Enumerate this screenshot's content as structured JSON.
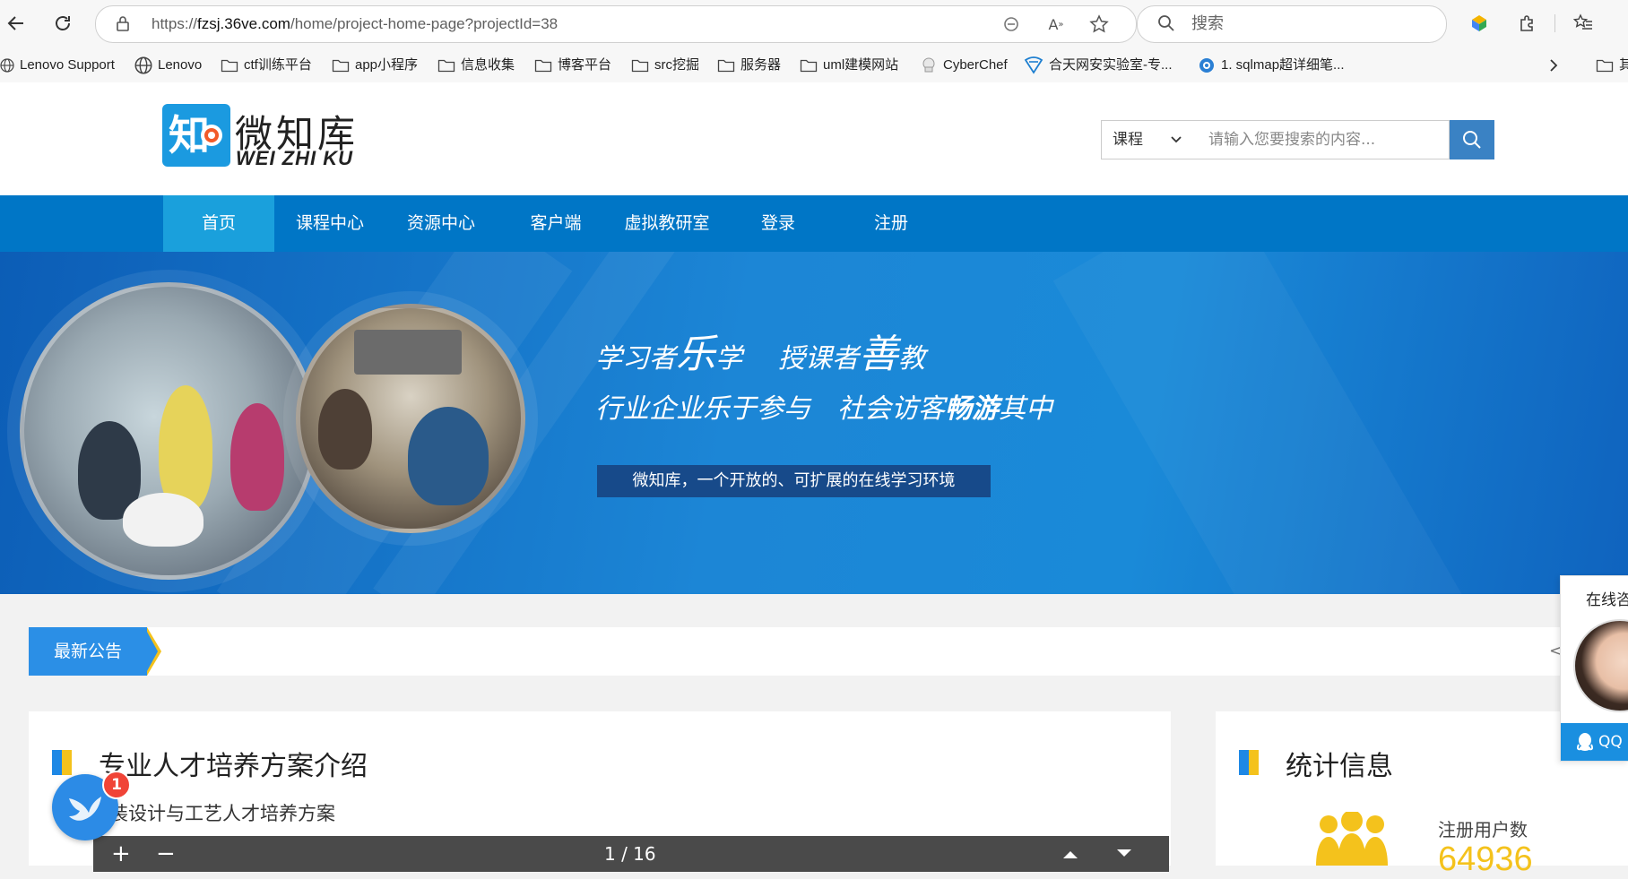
{
  "browser": {
    "url_scheme": "https://",
    "url_host": "fzsj.36ve.com",
    "url_path": "/home/project-home-page?projectId=38",
    "search_placeholder": "搜索"
  },
  "bookmarks": [
    {
      "label": "Lenovo Support",
      "icon": "globe-icon"
    },
    {
      "label": "Lenovo",
      "icon": "globe-icon"
    },
    {
      "label": "ctf训练平台",
      "icon": "folder-icon"
    },
    {
      "label": "app小程序",
      "icon": "folder-icon"
    },
    {
      "label": "信息收集",
      "icon": "folder-icon"
    },
    {
      "label": "博客平台",
      "icon": "folder-icon"
    },
    {
      "label": "src挖掘",
      "icon": "folder-icon"
    },
    {
      "label": "服务器",
      "icon": "folder-icon"
    },
    {
      "label": "uml建模网站",
      "icon": "folder-icon"
    },
    {
      "label": "CyberChef",
      "icon": "chef-icon"
    },
    {
      "label": "合天网安实验室-专...",
      "icon": "shield-icon"
    },
    {
      "label": "1. sqlmap超详细笔...",
      "icon": "site-icon"
    },
    {
      "label": "其",
      "icon": "folder-icon"
    }
  ],
  "site": {
    "logo_char": "知",
    "logo_cn": "微知库",
    "logo_en": "WEI ZHI KU",
    "search_category": "课程",
    "search_placeholder": "请输入您要搜索的内容..."
  },
  "nav": [
    "首页",
    "课程中心",
    "资源中心",
    "客户端",
    "虚拟教研室",
    "登录",
    "注册"
  ],
  "banner": {
    "line1_a": "学习者",
    "line1_b": "乐",
    "line1_c": "学",
    "line1_d": "授课者",
    "line1_e": "善",
    "line1_f": "教",
    "line2_a": "行业企业乐于参与",
    "line2_b": "社会访客",
    "line2_c": "畅游",
    "line2_d": "其中",
    "tagline": "微知库，一个开放的、可扩展的在线学习环境"
  },
  "notice": {
    "label": "最新公告",
    "prev": "<"
  },
  "program": {
    "title": "专业人才培养方案介绍",
    "subtitle": "装设计与工艺人才培养方案",
    "pdf_zoom_in": "+",
    "pdf_zoom_out": "−",
    "pdf_page": "1 / 16"
  },
  "stats": {
    "title": "统计信息",
    "users_label": "注册用户数",
    "users_value": "64936"
  },
  "online": {
    "title": "在线咨询",
    "qq": "QQ"
  },
  "float_badge": "1",
  "colors": {
    "nav_blue": "#0076c6",
    "nav_active": "#1aa0dc",
    "accent_yellow": "#f4c21c"
  }
}
